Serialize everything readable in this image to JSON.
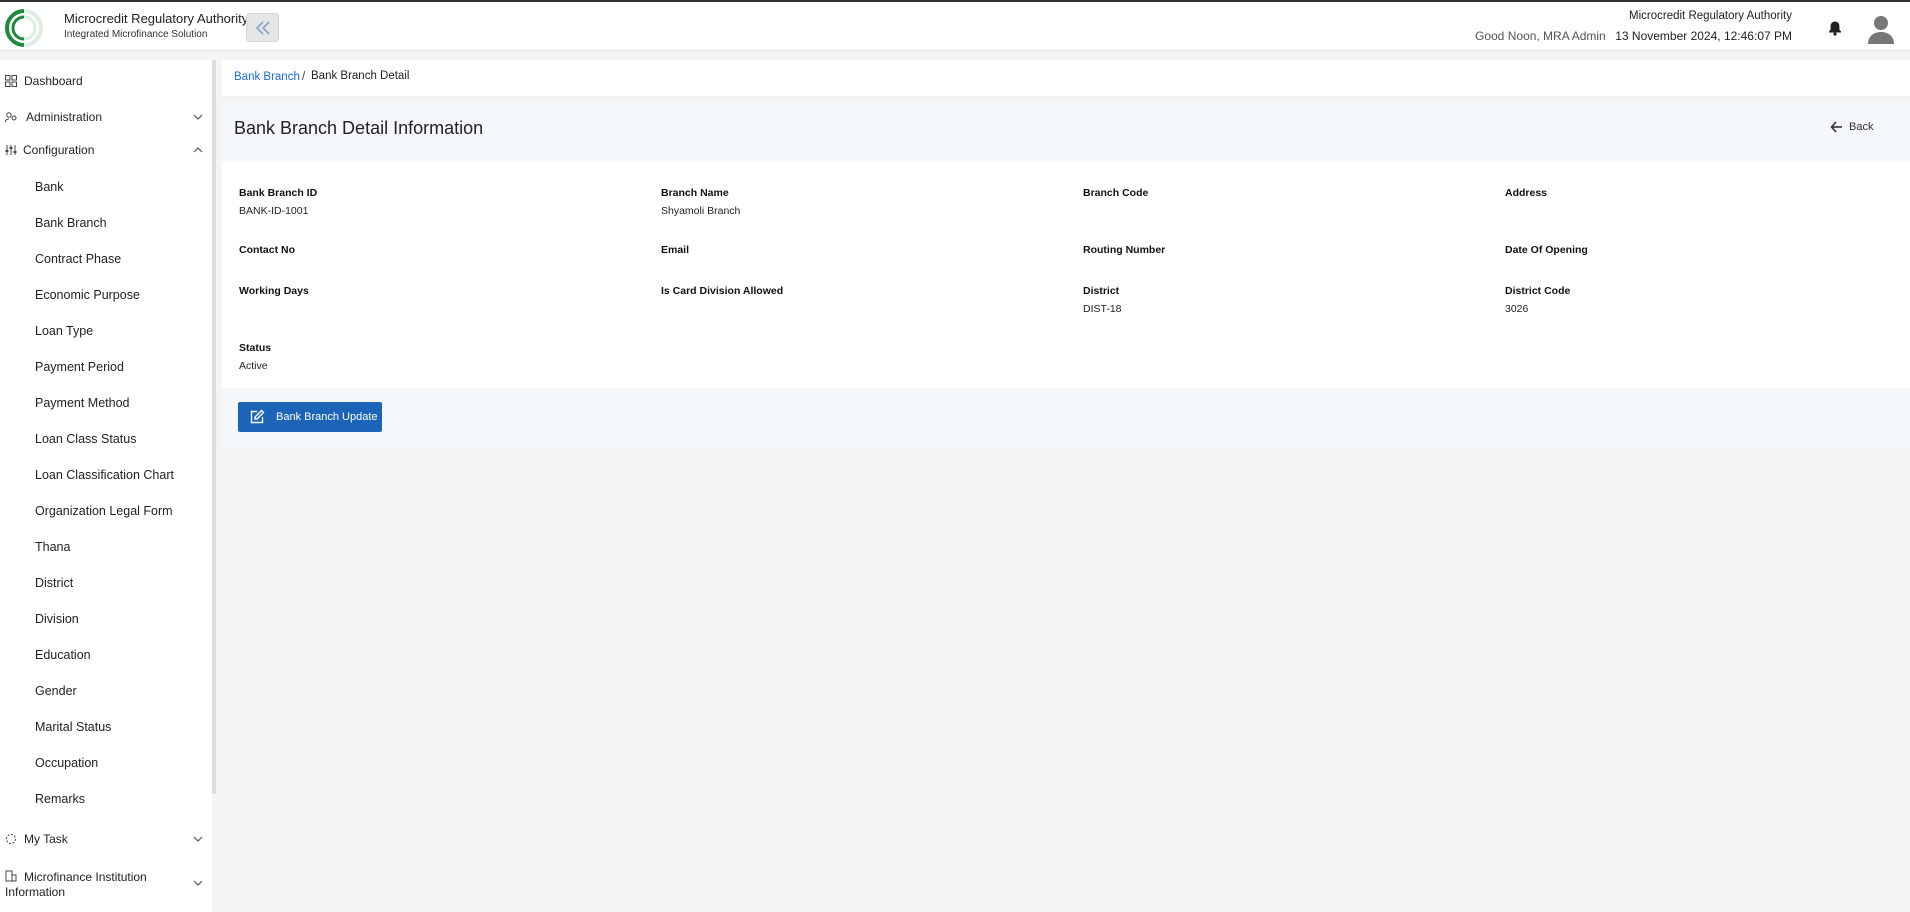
{
  "header": {
    "logo_text": "Microcredit Regulatory Authority",
    "title": "Microcredit Regulatory Authority",
    "subtitle": "Integrated Microfinance Solution",
    "greeting": "Good Noon, MRA Admin",
    "org_name": "Microcredit Regulatory Authority",
    "datetime": "13 November 2024, 12:46:07 PM"
  },
  "sidebar": {
    "dashboard": "Dashboard",
    "administration": "Administration",
    "configuration": "Configuration",
    "config_items": [
      "Bank",
      "Bank Branch",
      "Contract Phase",
      "Economic Purpose",
      "Loan Type",
      "Payment Period",
      "Payment Method",
      "Loan Class Status",
      "Loan Classification Chart",
      "Organization Legal Form",
      "Thana",
      "District",
      "Division",
      "Education",
      "Gender",
      "Marital Status",
      "Occupation",
      "Remarks"
    ],
    "my_task": "My Task",
    "mfi_line1": "Microfinance Institution",
    "mfi_line2": "Information"
  },
  "breadcrumb": {
    "parent": "Bank Branch",
    "separator": "/",
    "current": "Bank Branch Detail"
  },
  "page": {
    "title": "Bank Branch Detail Information",
    "back_label": "Back",
    "update_label": "Bank Branch Update"
  },
  "fields": [
    {
      "label": "Bank Branch ID",
      "value": "BANK-ID-1001"
    },
    {
      "label": "Branch Name",
      "value": "Shyamoli Branch"
    },
    {
      "label": "Branch Code",
      "value": ""
    },
    {
      "label": "Address",
      "value": ""
    },
    {
      "label": "Contact No",
      "value": ""
    },
    {
      "label": "Email",
      "value": ""
    },
    {
      "label": "Routing Number",
      "value": ""
    },
    {
      "label": "Date Of Opening",
      "value": ""
    },
    {
      "label": "Working Days",
      "value": ""
    },
    {
      "label": "Is Card Division Allowed",
      "value": ""
    },
    {
      "label": "District",
      "value": "DIST-18"
    },
    {
      "label": "District Code",
      "value": "3026"
    },
    {
      "label": "Status",
      "value": "Active"
    }
  ],
  "colors": {
    "primary": "#1b64b8",
    "link": "#1a6bd1",
    "logo_green": "#1f8a3c"
  }
}
